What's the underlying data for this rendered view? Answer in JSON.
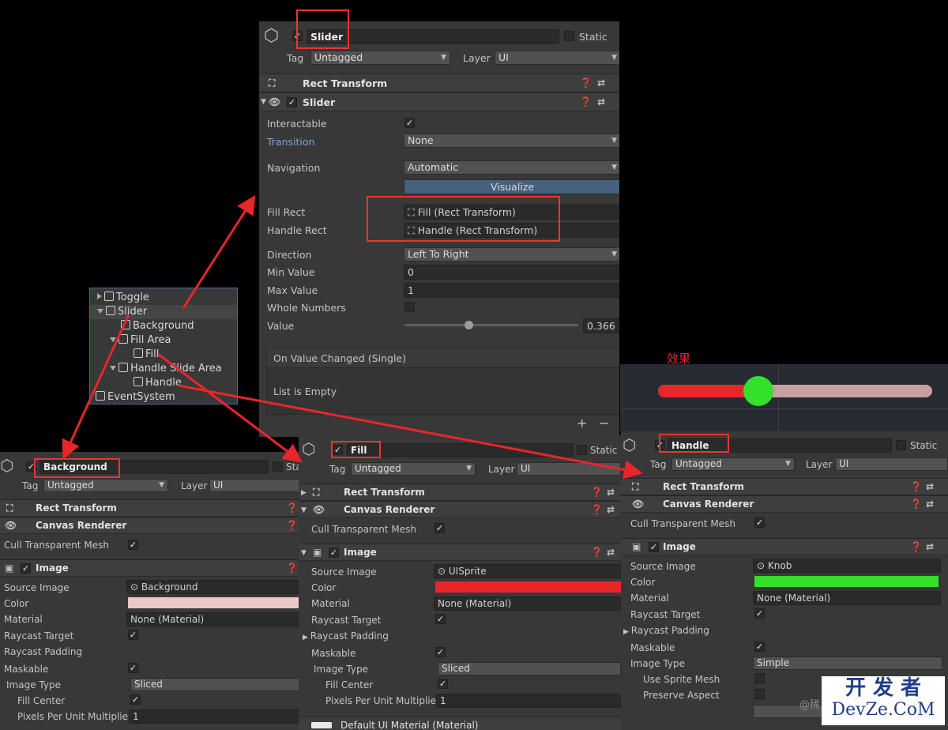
{
  "slider_inspector": {
    "name": "Slider",
    "static_label": "Static",
    "tag_label": "Tag",
    "tag_value": "Untagged",
    "layer_label": "Layer",
    "layer_value": "UI",
    "rect_transform": "Rect Transform",
    "component": "Slider",
    "interactable": "Interactable",
    "transition": "Transition",
    "transition_value": "None",
    "navigation": "Navigation",
    "navigation_value": "Automatic",
    "visualize": "Visualize",
    "fill_rect": "Fill Rect",
    "fill_rect_value": "Fill (Rect Transform)",
    "handle_rect": "Handle Rect",
    "handle_rect_value": "Handle (Rect Transform)",
    "direction": "Direction",
    "direction_value": "Left To Right",
    "min_value": "Min Value",
    "min_value_value": "0",
    "max_value": "Max Value",
    "max_value_value": "1",
    "whole_numbers": "Whole Numbers",
    "value": "Value",
    "value_value": "0.366",
    "value_fraction": 0.366,
    "on_value_changed": "On Value Changed (Single)",
    "list_empty": "List is Empty",
    "plus": "+",
    "minus": "−"
  },
  "hierarchy": {
    "items": [
      "Toggle",
      "Slider",
      "Background",
      "Fill Area",
      "Fill",
      "Handle Slide Area",
      "Handle",
      "EventSystem"
    ]
  },
  "effect": {
    "label": "效果",
    "fill_color": "#e8262a",
    "track_color": "#c9a0a2",
    "handle_color": "#33e02c"
  },
  "background_inspector": {
    "name": "Background",
    "static_label": "Sta",
    "tag_label": "Tag",
    "tag_value": "Untagged",
    "layer_label": "Layer",
    "layer_value": "UI",
    "rect_transform": "Rect Transform",
    "canvas_renderer": "Canvas Renderer",
    "cull": "Cull Transparent Mesh",
    "image": "Image",
    "source_image": "Source Image",
    "source_image_value": "Background",
    "color": "Color",
    "color_value": "#ebc9c9",
    "material": "Material",
    "material_value": "None (Material)",
    "raycast_target": "Raycast Target",
    "raycast_padding": "Raycast Padding",
    "maskable": "Maskable",
    "image_type": "Image Type",
    "image_type_value": "Sliced",
    "fill_center": "Fill Center",
    "ppu": "Pixels Per Unit Multiplier",
    "ppu_value": "1"
  },
  "fill_inspector": {
    "name": "Fill",
    "static_label": "Static",
    "tag_label": "Tag",
    "tag_value": "Untagged",
    "layer_label": "Layer",
    "layer_value": "UI",
    "rect_transform": "Rect Transform",
    "canvas_renderer": "Canvas Renderer",
    "cull": "Cull Transparent Mesh",
    "image": "Image",
    "source_image": "Source Image",
    "source_image_value": "UISprite",
    "color": "Color",
    "color_value": "#e8262a",
    "material": "Material",
    "material_value": "None (Material)",
    "raycast_target": "Raycast Target",
    "raycast_padding": "Raycast Padding",
    "maskable": "Maskable",
    "image_type": "Image Type",
    "image_type_value": "Sliced",
    "fill_center": "Fill Center",
    "ppu": "Pixels Per Unit Multiplier",
    "ppu_value": "1",
    "default_material": "Default UI Material (Material)"
  },
  "handle_inspector": {
    "name": "Handle",
    "static_label": "Static",
    "tag_label": "Tag",
    "tag_value": "Untagged",
    "layer_label": "Layer",
    "layer_value": "UI",
    "rect_transform": "Rect Transform",
    "canvas_renderer": "Canvas Renderer",
    "cull": "Cull Transparent Mesh",
    "image": "Image",
    "source_image": "Source Image",
    "source_image_value": "Knob",
    "color": "Color",
    "color_value": "#33e02c",
    "material": "Material",
    "material_value": "None (Material)",
    "raycast_target": "Raycast Target",
    "raycast_padding": "Raycast Padding",
    "maskable": "Maskable",
    "image_type": "Image Type",
    "image_type_value": "Simple",
    "use_sprite_mesh": "Use Sprite Mesh",
    "preserve_aspect": "Preserve Aspect"
  },
  "watermark": {
    "line1": "开 发 者",
    "line2": "DevZe.CoM",
    "handle": "@稀"
  },
  "colors": {
    "annotation_red": "#e8262a",
    "selection_blue": "#3e6ea9"
  }
}
